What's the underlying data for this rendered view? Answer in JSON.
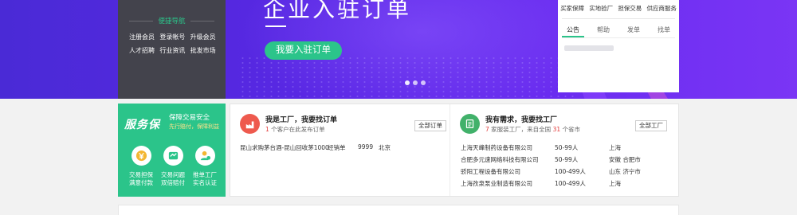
{
  "hero": {
    "title": "企业入驻订单",
    "cta_label": "我要入驻订单",
    "slide_count": 3
  },
  "quick_nav": {
    "heading": "便捷导航",
    "links": [
      "注册会员",
      "登录帐号",
      "升级会员",
      "人才招聘",
      "行业资讯",
      "批发市场"
    ]
  },
  "notice_box": {
    "top_links": [
      "买家保障",
      "实地验厂",
      "担保交易",
      "供应商服务"
    ],
    "tabs": [
      "公告",
      "帮助",
      "发单",
      "找单"
    ],
    "active_tab": "公告"
  },
  "service": {
    "logo": "服务保",
    "tagline": "保障交易安全",
    "sub_tagline": "先行赔付，保障利益",
    "items": [
      {
        "icon": "yen-coin-icon",
        "line1": "交易担保",
        "line2": "满意付款"
      },
      {
        "icon": "handshake-icon",
        "line1": "交易问题",
        "line2": "双倍赔付"
      },
      {
        "icon": "person-check-icon",
        "line1": "推单工厂",
        "line2": "实名认证"
      }
    ]
  },
  "factory_orders": {
    "title": "我是工厂，我要找订单",
    "count": "1",
    "sub_suffix": "个客户在此发布订单",
    "all_button": "全部订单",
    "rows": [
      {
        "name": "昆山求购茅台酒-昆山回收茅1000",
        "type": "经销单",
        "qty": "9999",
        "city": "北京"
      }
    ]
  },
  "demand": {
    "title": "我有需求，我要找工厂",
    "count_factories": "7",
    "text_mid": "家服装工厂，来自全国",
    "count_provinces": "31",
    "text_end": "个省市",
    "all_button": "全部工厂",
    "rows": [
      {
        "name": "上海天峰制药设备有限公司",
        "size": "50-99人",
        "location": "上海"
      },
      {
        "name": "合肥多元速网络科技有限公司",
        "size": "50-99人",
        "location": "安徽 合肥市"
      },
      {
        "name": "骄阳工程设备有限公司",
        "size": "100-499人",
        "location": "山东 济宁市"
      },
      {
        "name": "上海孜泉泵业制造有限公司",
        "size": "100-499人",
        "location": "上海"
      }
    ]
  },
  "colors": {
    "accent_green": "#2bc48a",
    "hero_purple": "#5b27e6",
    "highlight_red": "#e23b3b"
  }
}
